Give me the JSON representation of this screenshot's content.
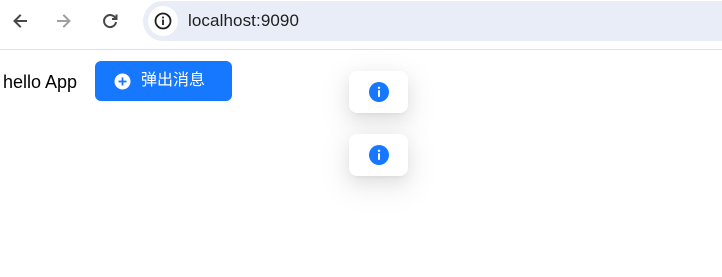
{
  "browser": {
    "back_icon": "arrow-left-icon",
    "forward_icon": "arrow-right-icon",
    "reload_icon": "reload-icon",
    "site_info_icon": "info-icon",
    "url": "localhost:9090"
  },
  "page": {
    "hello_text": "hello App",
    "popup_button": {
      "icon": "plus-circle-icon",
      "label": "弹出消息"
    },
    "messages": [
      {
        "icon": "info-circle-icon",
        "text": ""
      },
      {
        "icon": "info-circle-icon",
        "text": ""
      }
    ]
  },
  "colors": {
    "primary": "#1677ff",
    "address_bar_bg": "#e9edf7",
    "toolbar_icon": "#474747",
    "toolbar_icon_disabled": "#a0a0a0"
  }
}
